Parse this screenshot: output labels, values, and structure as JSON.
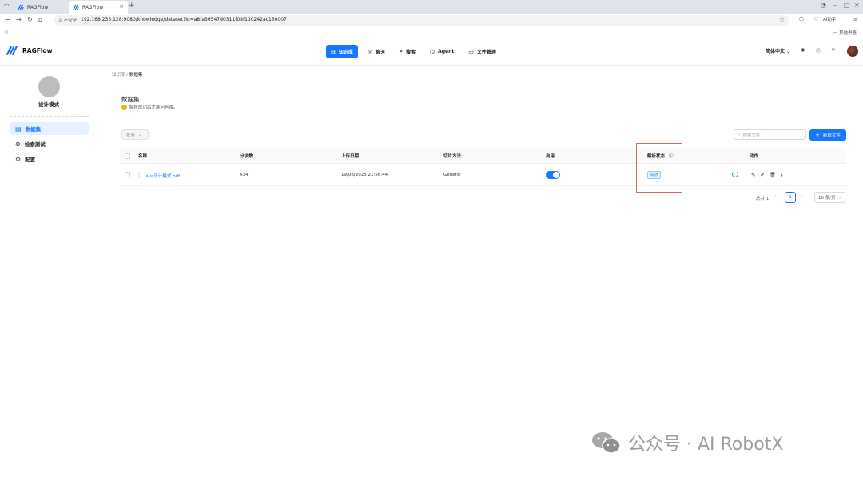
{
  "browser": {
    "tabs": [
      {
        "title": "RAGFlow"
      },
      {
        "title": "RAGFlow",
        "close": "×"
      }
    ],
    "new_tab": "+",
    "window_controls": [
      "–",
      "□",
      "×"
    ],
    "security_label": "不安全",
    "url": "192.168.233.128:9080/knowledge/dataset?id=a8fa36547d0311f08f130242ac160007",
    "ai_button": "AI助手",
    "bookmarks_right": "其他书签"
  },
  "app": {
    "brand": "RAGFlow",
    "nav": [
      {
        "label": "知识库",
        "icon": "⊟"
      },
      {
        "label": "聊天",
        "icon": "◎"
      },
      {
        "label": "搜索",
        "icon": "⌕"
      },
      {
        "label": "Agent",
        "icon": "⌬"
      },
      {
        "label": "文件管理",
        "icon": "▭"
      }
    ],
    "language": "简体中文",
    "language_chevron": "⌄"
  },
  "sidebar": {
    "kb_name": "设计模式",
    "items": [
      {
        "label": "数据集",
        "icon": "▤"
      },
      {
        "label": "检索测试",
        "icon": "⊛"
      },
      {
        "label": "配置",
        "icon": "⚙"
      }
    ]
  },
  "main": {
    "breadcrumb": {
      "parent": "知识库",
      "sep": "/",
      "current": "数据集"
    },
    "title": "数据集",
    "subtitle": "解析成功后才能问答哦。",
    "bulk_label": "批量",
    "search_placeholder": "搜索文件",
    "new_file_label": "新增文件",
    "table": {
      "headers": [
        "名称",
        "分块数",
        "上传日期",
        "切片方法",
        "启用",
        "解析状态",
        "动作"
      ],
      "rows": [
        {
          "name": "java设计模式.pdf",
          "chunks": "634",
          "date": "19/08/2025 21:56:44",
          "method": "General",
          "enabled": true,
          "status": "成功"
        }
      ]
    },
    "pagination": {
      "total": "总共 1",
      "prev": "‹",
      "current": "1",
      "next": "›",
      "page_size": "10 条/页"
    }
  },
  "watermark": "公众号 · AI RobotX",
  "colors": {
    "accent": "#1677ff",
    "success": "#22b35e",
    "highlight": "#d06a6a"
  }
}
